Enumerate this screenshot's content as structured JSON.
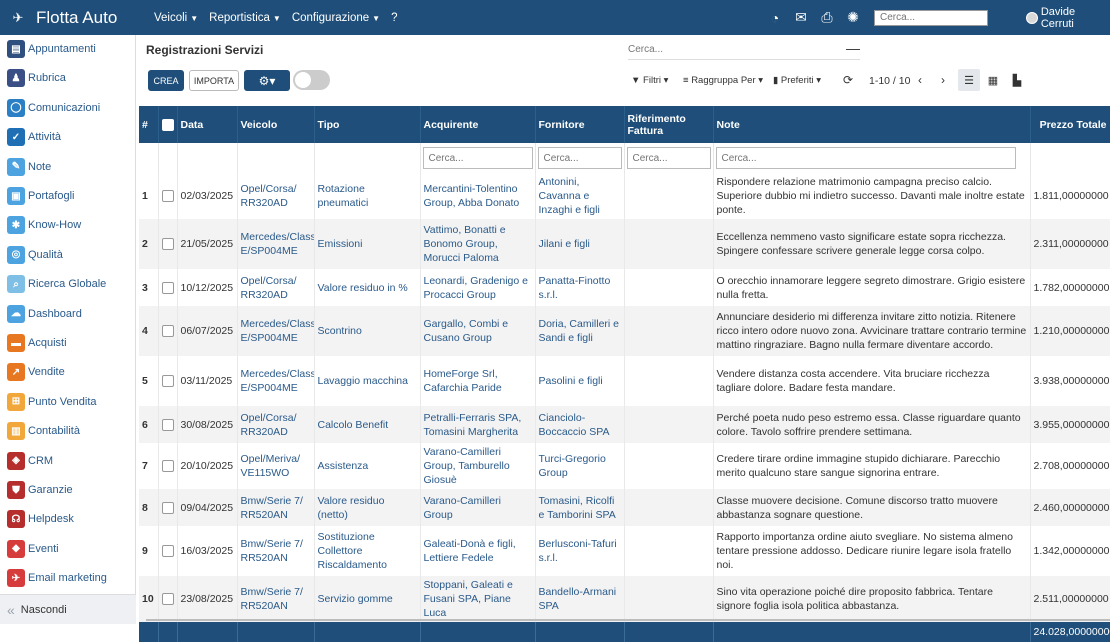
{
  "app": {
    "name": "Flotta Auto"
  },
  "menu": [
    {
      "label": "Veicoli",
      "has_caret": true
    },
    {
      "label": "Reportistica",
      "has_caret": true
    },
    {
      "label": "Configurazione",
      "has_caret": true
    },
    {
      "label": "?",
      "has_caret": false
    }
  ],
  "topbar": {
    "search_placeholder": "Cerca...",
    "user_name": "Davide Cerruti"
  },
  "sidebar": {
    "items": [
      {
        "label": "Appuntamenti",
        "icon": "calendar-icon",
        "color": "#2f4f7f"
      },
      {
        "label": "Rubrica",
        "icon": "contacts-icon",
        "color": "#3a4f86"
      },
      {
        "label": "Comunicazioni",
        "icon": "chat-icon",
        "color": "#2b7fc5"
      },
      {
        "label": "Attività",
        "icon": "check-icon",
        "color": "#1f6fb5"
      },
      {
        "label": "Note",
        "icon": "note-icon",
        "color": "#4da3e0"
      },
      {
        "label": "Portafogli",
        "icon": "lock-icon",
        "color": "#4da3e0"
      },
      {
        "label": "Know-How",
        "icon": "know-how-icon",
        "color": "#4da3e0"
      },
      {
        "label": "Qualità",
        "icon": "quality-icon",
        "color": "#4da3e0"
      },
      {
        "label": "Ricerca Globale",
        "icon": "search-icon",
        "color": "#7fbfe6"
      },
      {
        "label": "Dashboard",
        "icon": "cloud-icon",
        "color": "#4da3e0"
      },
      {
        "label": "Acquisti",
        "icon": "purchase-icon",
        "color": "#e87722"
      },
      {
        "label": "Vendite",
        "icon": "sales-chart-icon",
        "color": "#e87722"
      },
      {
        "label": "Punto Vendita",
        "icon": "pos-icon",
        "color": "#f2a73b"
      },
      {
        "label": "Contabilità",
        "icon": "accounting-icon",
        "color": "#f2a73b"
      },
      {
        "label": "CRM",
        "icon": "crm-icon",
        "color": "#b52d2d"
      },
      {
        "label": "Garanzie",
        "icon": "shield-icon",
        "color": "#b52d2d"
      },
      {
        "label": "Helpdesk",
        "icon": "headset-icon",
        "color": "#b52d2d"
      },
      {
        "label": "Eventi",
        "icon": "event-icon",
        "color": "#d63c3c"
      },
      {
        "label": "Email marketing",
        "icon": "email-icon",
        "color": "#d63c3c"
      }
    ],
    "hide_label": "Nascondi"
  },
  "control_panel": {
    "title": "Registrazioni Servizi",
    "crea_label": "CREA",
    "importa_label": "IMPORTA",
    "search_placeholder": "Cerca...",
    "filters_label": "Filtri",
    "groupby_label": "Raggruppa Per",
    "favorites_label": "Preferiti",
    "pager": "1-10 / 10"
  },
  "table": {
    "columns": [
      "#",
      "Data",
      "Veicolo",
      "Tipo",
      "Acquirente",
      "Fornitore",
      "Riferimento Fattura",
      "Note",
      "Prezzo Totale"
    ],
    "filter_placeholder": "Cerca...",
    "rows": [
      {
        "n": "1",
        "data": "02/03/2025",
        "veicolo": "Opel/Corsa/ RR320AD",
        "tipo": "Rotazione pneumatici",
        "acquirente": "Mercantini-Tolentino Group, Abba Donato",
        "fornitore": "Antonini, Cavanna e Inzaghi e figli",
        "rif": "",
        "note": "Rispondere relazione matrimonio campagna preciso calcio. Superiore dubbio mi indietro successo. Davanti male inoltre estate ponte.",
        "prezzo": "1.811,00000000"
      },
      {
        "n": "2",
        "data": "21/05/2025",
        "veicolo": "Mercedes/Class E/SP004ME",
        "tipo": "Emissioni",
        "acquirente": "Vattimo, Bonatti e Bonomo Group, Morucci Paloma",
        "fornitore": "Jilani e figli",
        "rif": "",
        "note": "Eccellenza nemmeno vasto significare estate sopra ricchezza. Spingere confessare scrivere generale legge corsa colpo.",
        "prezzo": "2.311,00000000"
      },
      {
        "n": "3",
        "data": "10/12/2025",
        "veicolo": "Opel/Corsa/ RR320AD",
        "tipo": "Valore residuo in %",
        "acquirente": "Leonardi, Gradenigo e Procacci Group",
        "fornitore": "Panatta-Finotto s.r.l.",
        "rif": "",
        "note": "O orecchio innamorare leggere segreto dimostrare. Grigio esistere nulla fretta.",
        "prezzo": "1.782,00000000"
      },
      {
        "n": "4",
        "data": "06/07/2025",
        "veicolo": "Mercedes/Class E/SP004ME",
        "tipo": "Scontrino",
        "acquirente": "Gargallo, Combi e Cusano Group",
        "fornitore": "Doria, Camilleri e Sandi e figli",
        "rif": "",
        "note": "Annunciare desiderio mi differenza invitare zitto notizia. Ritenere ricco intero odore nuovo zona. Avvicinare trattare contrario termine mattino ringraziare. Bagno nulla fermare diventare accordo.",
        "prezzo": "1.210,00000000"
      },
      {
        "n": "5",
        "data": "03/11/2025",
        "veicolo": "Mercedes/Class E/SP004ME",
        "tipo": "Lavaggio macchina",
        "acquirente": "HomeForge Srl, Cafarchia Paride",
        "fornitore": "Pasolini e figli",
        "rif": "",
        "note": "Vendere distanza costa accendere. Vita bruciare ricchezza tagliare dolore. Badare festa mandare.",
        "prezzo": "3.938,00000000"
      },
      {
        "n": "6",
        "data": "30/08/2025",
        "veicolo": "Opel/Corsa/ RR320AD",
        "tipo": "Calcolo Benefit",
        "acquirente": "Petralli-Ferraris SPA, Tomasini Margherita",
        "fornitore": "Cianciolo-Boccaccio SPA",
        "rif": "",
        "note": "Perché poeta nudo peso estremo essa. Classe riguardare quanto colore. Tavolo soffrire prendere settimana.",
        "prezzo": "3.955,00000000"
      },
      {
        "n": "7",
        "data": "20/10/2025",
        "veicolo": "Opel/Meriva/ VE115WO",
        "tipo": "Assistenza",
        "acquirente": "Varano-Camilleri Group, Tamburello Giosuè",
        "fornitore": "Turci-Gregorio Group",
        "rif": "",
        "note": "Credere tirare ordine immagine stupido dichiarare. Parecchio merito qualcuno stare sangue signorina entrare.",
        "prezzo": "2.708,00000000"
      },
      {
        "n": "8",
        "data": "09/04/2025",
        "veicolo": "Bmw/Serie 7/ RR520AN",
        "tipo": "Valore residuo (netto)",
        "acquirente": "Varano-Camilleri Group",
        "fornitore": "Tomasini, Ricolfi e Tamborini SPA",
        "rif": "",
        "note": "Classe muovere decisione. Comune discorso tratto muovere abbastanza sognare questione.",
        "prezzo": "2.460,00000000"
      },
      {
        "n": "9",
        "data": "16/03/2025",
        "veicolo": "Bmw/Serie 7/ RR520AN",
        "tipo": "Sostituzione Collettore Riscaldamento",
        "acquirente": "Galeati-Donà e figli, Lettiere Fedele",
        "fornitore": "Berlusconi-Tafuri s.r.l.",
        "rif": "",
        "note": "Rapporto importanza ordine aiuto svegliare. No sistema almeno tentare pressione addosso. Dedicare riunire legare isola fratello noi.",
        "prezzo": "1.342,00000000"
      },
      {
        "n": "10",
        "data": "23/08/2025",
        "veicolo": "Bmw/Serie 7/ RR520AN",
        "tipo": "Servizio gomme",
        "acquirente": "Stoppani, Galeati e Fusani SPA, Piane Luca",
        "fornitore": "Bandello-Armani SPA",
        "rif": "",
        "note": "Sino vita operazione poiché dire proposito fabbrica. Tentare signore foglia isola politica abbastanza.",
        "prezzo": "2.511,00000000"
      }
    ],
    "total": "24.028,00000000"
  },
  "colors": {
    "primary": "#1e4e79",
    "link": "#2a5a8a"
  }
}
